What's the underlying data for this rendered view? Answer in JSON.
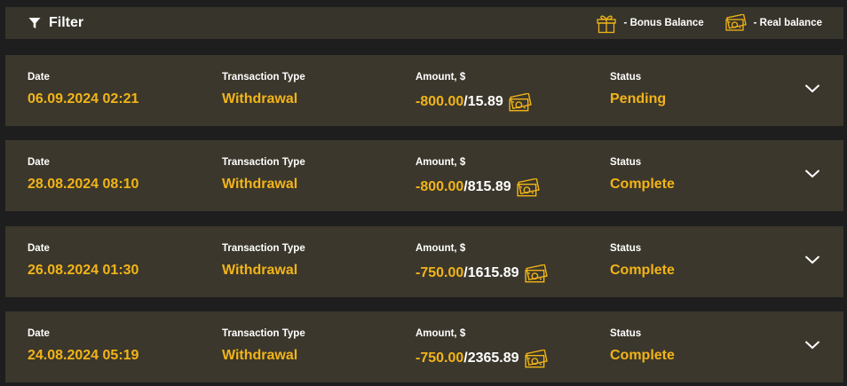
{
  "filter": {
    "label": "Filter",
    "icon": "funnel-icon"
  },
  "legend": {
    "bonus_label": "- Bonus Balance",
    "bonus_icon": "gift-icon",
    "real_label": "- Real balance",
    "real_icon": "cash-icon"
  },
  "columns": {
    "date": "Date",
    "type": "Transaction Type",
    "amount": "Amount, $",
    "status": "Status"
  },
  "colors": {
    "accent": "#f2b418",
    "row_bg": "#3b372c",
    "page_bg": "#1e1e1e"
  },
  "transactions": [
    {
      "date": "06.09.2024 02:21",
      "type": "Withdrawal",
      "amount": "-800.00",
      "balance": "/15.89",
      "status": "Pending"
    },
    {
      "date": "28.08.2024 08:10",
      "type": "Withdrawal",
      "amount": "-800.00",
      "balance": "/815.89",
      "status": "Complete"
    },
    {
      "date": "26.08.2024 01:30",
      "type": "Withdrawal",
      "amount": "-750.00",
      "balance": "/1615.89",
      "status": "Complete"
    },
    {
      "date": "24.08.2024 05:19",
      "type": "Withdrawal",
      "amount": "-750.00",
      "balance": "/2365.89",
      "status": "Complete"
    }
  ]
}
